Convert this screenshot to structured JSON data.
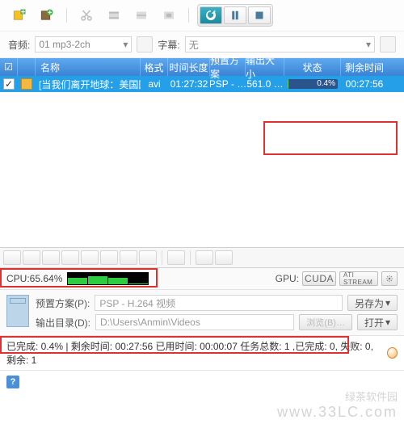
{
  "toolbar": {
    "icons": [
      "add-media",
      "film-plus",
      "scissors",
      "film-trim",
      "film-cut",
      "film-edit",
      "refresh",
      "pause",
      "stop"
    ]
  },
  "meta": {
    "audio_label": "音频:",
    "audio_value": "01 mp3-2ch",
    "subtitle_label": "字幕:",
    "subtitle_value": "无"
  },
  "columns": {
    "chk": "",
    "name": "名称",
    "fmt": "格式",
    "dur": "时间长度",
    "preset": "预置方案",
    "outsize": "输出大小",
    "state": "状态",
    "remain": "剩余时间"
  },
  "task": {
    "checked": "✓",
    "name": "[当我们离开地球：美国国家…",
    "fmt": "avi",
    "dur": "01:27:32",
    "preset": "PSP - …",
    "outsize": "561.0 …",
    "pct": "0.4%",
    "remain": "00:27:56"
  },
  "cpu": {
    "label": "CPU:65.64%",
    "cores": [
      60,
      68,
      58,
      8
    ],
    "gpu_label": "GPU:",
    "cuda": "CUDA",
    "ati": "ATI STREAM"
  },
  "settings": {
    "preset_label": "预置方案(P):",
    "preset_value": "PSP - H.264 视频",
    "saveas": "另存为",
    "outdir_label": "输出目录(D):",
    "outdir_value": "D:\\Users\\Anmin\\Videos",
    "browse": "浏览(B)…",
    "open": "打开"
  },
  "status": {
    "text": "已完成: 0.4% | 剩余时间: 00:27:56 已用时间: 00:00:07 任务总数: 1 ,已完成: 0, 失败: 0, 剩余: 1"
  },
  "watermark": {
    "site": "绿茶软件园",
    "url": "www.33LC.com"
  }
}
